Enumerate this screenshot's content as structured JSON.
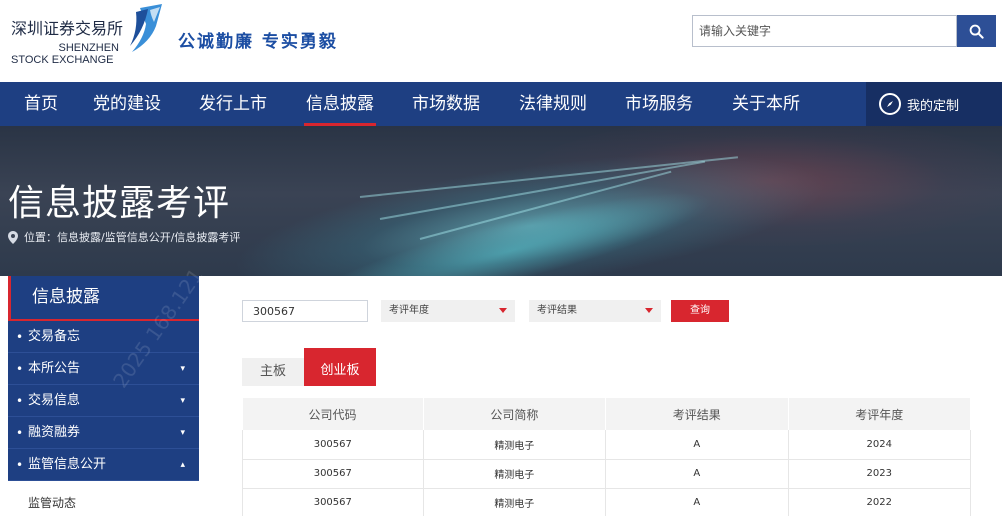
{
  "header": {
    "logo_cn": "深圳证券交易所",
    "logo_en_line1": "SHENZHEN",
    "logo_en_line2": "STOCK EXCHANGE",
    "slogan": "公诚勤廉 专实勇毅",
    "search_placeholder": "请输入关键字"
  },
  "nav": {
    "items": [
      "首页",
      "党的建设",
      "发行上市",
      "信息披露",
      "市场数据",
      "法律规则",
      "市场服务",
      "关于本所"
    ],
    "active": "信息披露",
    "my_custom": "我的定制"
  },
  "banner": {
    "title": "信息披露考评",
    "breadcrumb": "位置：信息披露/监管信息公开/信息披露考评"
  },
  "sidebar": {
    "title": "信息披露",
    "items": [
      {
        "label": "交易备忘",
        "has_arrow": false
      },
      {
        "label": "本所公告",
        "has_arrow": true
      },
      {
        "label": "交易信息",
        "has_arrow": true
      },
      {
        "label": "融资融券",
        "has_arrow": true
      },
      {
        "label": "监管信息公开",
        "has_arrow": true,
        "expanded": true
      }
    ],
    "sub_item": "监管动态",
    "watermark": "2025 168.121"
  },
  "filters": {
    "code_value": "300567",
    "year_select": "考评年度",
    "result_select": "考评结果",
    "query_button": "查询"
  },
  "tabs": {
    "main_board": "主板",
    "gem_board": "创业板",
    "active": "创业板"
  },
  "table": {
    "headers": [
      "公司代码",
      "公司简称",
      "考评结果",
      "考评年度"
    ],
    "rows": [
      [
        "300567",
        "精测电子",
        "A",
        "2024"
      ],
      [
        "300567",
        "精测电子",
        "A",
        "2023"
      ],
      [
        "300567",
        "精测电子",
        "A",
        "2022"
      ]
    ]
  },
  "colors": {
    "nav_blue": "#1e3f82",
    "accent_red": "#d8262f",
    "slogan_blue": "#1c4ea3"
  }
}
